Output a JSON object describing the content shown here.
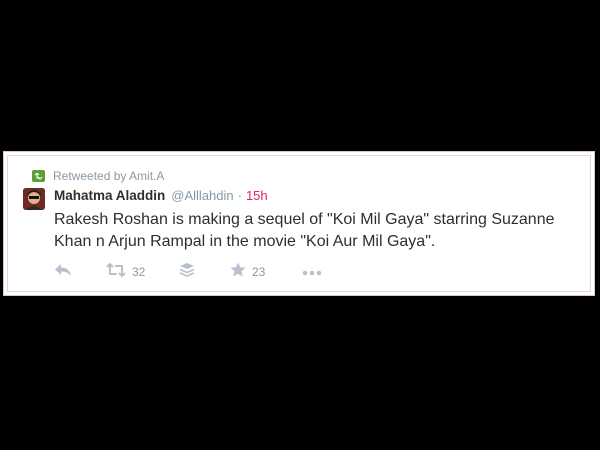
{
  "retweet": {
    "label": "Retweeted by Amit.A"
  },
  "tweet": {
    "author_name": "Mahatma Aladdin",
    "handle": "@Alllahdin",
    "separator": "·",
    "time": "15h",
    "text": "Rakesh Roshan is making a sequel of \"Koi Mil Gaya\" starring Suzanne Khan n Arjun Rampal in the movie \"Koi Aur Mil Gaya\"."
  },
  "actions": {
    "retweet_count": "32",
    "favorite_count": "23"
  },
  "icons": {
    "retweeted_by": "retweet-icon",
    "reply": "reply-icon",
    "retweet": "retweet-icon",
    "buffer": "buffer-stack-icon",
    "favorite": "star-icon",
    "more": "more-dots-icon"
  },
  "colors": {
    "background": "#000000",
    "card_border": "#d8c9c9",
    "retweet_badge": "#5c9f33",
    "time_accent": "#e0245e",
    "muted": "#8899a6",
    "text": "#292f33"
  }
}
